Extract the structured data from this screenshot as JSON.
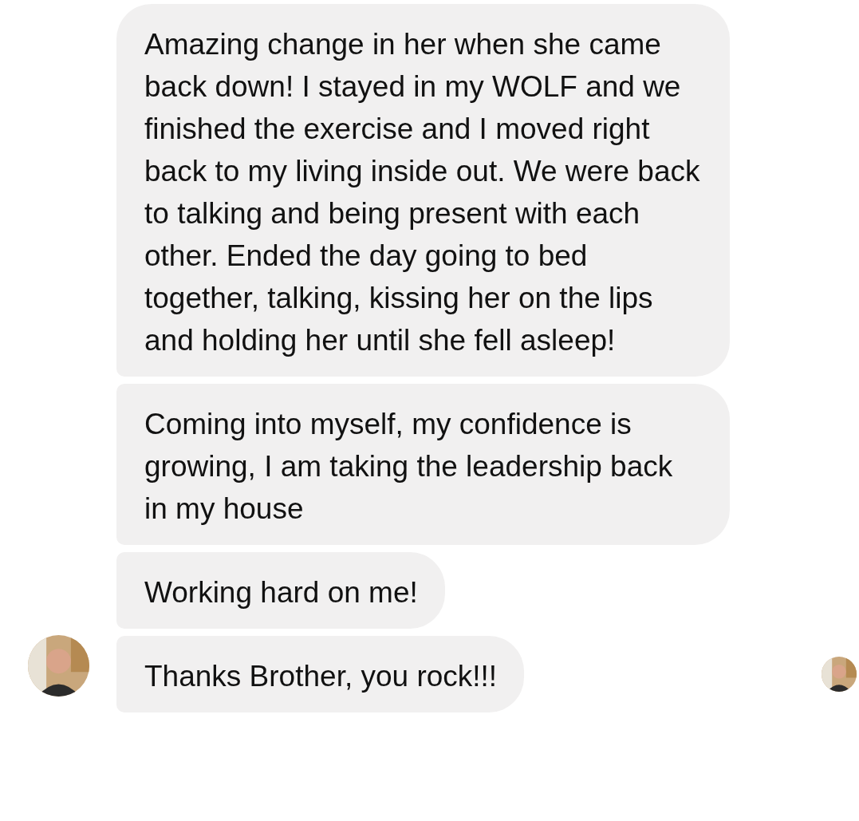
{
  "messages": [
    {
      "text": "Amazing change in her when she came back down! I stayed in my WOLF and we finished the exercise and I moved right back to my living inside out. We were back to talking and being present with each other. Ended the day going to bed together, talking, kissing her on the lips and holding her until she fell asleep!"
    },
    {
      "text": "Coming into myself, my confidence is growing, I am taking the leadership back in my house"
    },
    {
      "text": "Working hard on me!"
    },
    {
      "text": "Thanks Brother, you rock!!!"
    }
  ]
}
